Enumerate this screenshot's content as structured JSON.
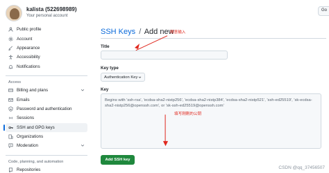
{
  "header": {
    "username": "kalista (522698989)",
    "subtitle": "Your personal account",
    "goto_label": "Go"
  },
  "sidebar": {
    "items_top": [
      {
        "name": "public-profile",
        "label": "Public profile",
        "icon": "person-icon"
      },
      {
        "name": "account",
        "label": "Account",
        "icon": "gear-icon"
      },
      {
        "name": "appearance",
        "label": "Appearance",
        "icon": "paintbrush-icon"
      },
      {
        "name": "accessibility",
        "label": "Accessibility",
        "icon": "accessibility-icon"
      },
      {
        "name": "notifications",
        "label": "Notifications",
        "icon": "bell-icon"
      }
    ],
    "access_heading": "Access",
    "items_access": [
      {
        "name": "billing",
        "label": "Billing and plans",
        "icon": "credit-card-icon",
        "expandable": true
      },
      {
        "name": "emails",
        "label": "Emails",
        "icon": "mail-icon"
      },
      {
        "name": "password",
        "label": "Password and authentication",
        "icon": "shield-lock-icon"
      },
      {
        "name": "sessions",
        "label": "Sessions",
        "icon": "broadcast-icon"
      },
      {
        "name": "ssh-gpg",
        "label": "SSH and GPG keys",
        "icon": "key-icon",
        "active": true
      },
      {
        "name": "organizations",
        "label": "Organizations",
        "icon": "organization-icon"
      },
      {
        "name": "moderation",
        "label": "Moderation",
        "icon": "report-icon",
        "expandable": true
      }
    ],
    "code_heading": "Code, planning, and automation",
    "items_code": [
      {
        "name": "repositories",
        "label": "Repositories",
        "icon": "repo-icon"
      }
    ]
  },
  "main": {
    "breadcrumb_link": "SSH Keys",
    "breadcrumb_sep": "/",
    "breadcrumb_current": "Add new",
    "title_label": "Title",
    "title_value": "",
    "key_type_label": "Key type",
    "key_type_value": "Authentication Key",
    "key_label": "Key",
    "key_placeholder": "Begins with 'ssh-rsa', 'ecdsa-sha2-nistp256', 'ecdsa-sha2-nistp384', 'ecdsa-sha2-nistp521', 'ssh-ed25519', 'sk-ecdsa-sha2-nistp256@openssh.com', or 'sk-ssh-ed25519@openssh.com'",
    "add_button": "Add SSH key"
  },
  "annotations": {
    "title_note": "随意输入",
    "key_note": "填写刚刚的公钥",
    "color": "#e0281e"
  },
  "watermark": "CSDN @qq_37456507"
}
